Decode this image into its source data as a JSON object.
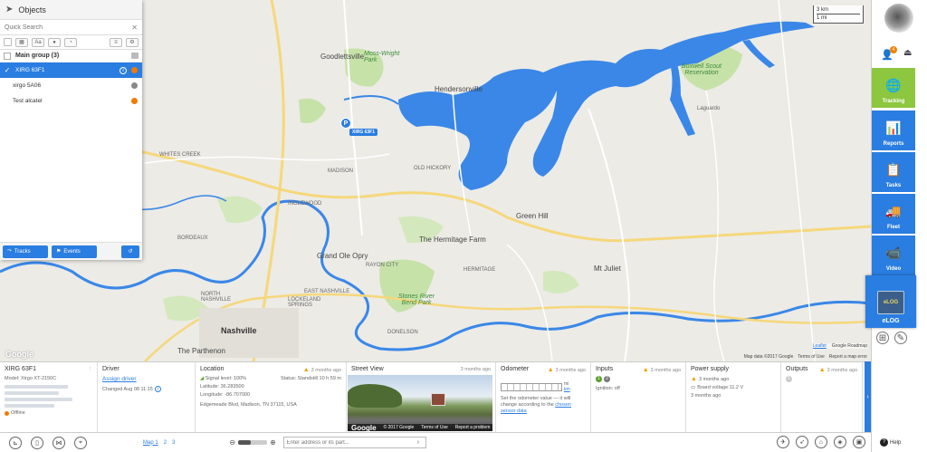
{
  "map": {
    "scale_km": "3 km",
    "scale_mi": "1 mi",
    "vehicle_marker": "P",
    "vehicle_tag": "XIRG 63F1",
    "labels": {
      "goodlettsville": "Goodlettsville",
      "moss_wright": "Moss-Wright Park",
      "hendersonville": "Hendersonville",
      "boxwell": "Boxwell Scout Reservation",
      "laguardo": "Laguardo",
      "madison": "MADISON",
      "old_hickory": "OLD HICKORY",
      "inglewood": "INGLEWOOD",
      "green_hill": "Green Hill",
      "hermitage": "The Hermitage Farm",
      "grand_ole_opry": "Grand Ole Opry",
      "mt_juliet": "Mt Juliet",
      "stones_river": "Stones River Bend Park",
      "nashville": "Nashville",
      "parthenon": "The Parthenon",
      "donelson": "DONELSON",
      "lockeland": "LOCKELAND SPRINGS",
      "east_nashville": "EAST NASHVILLE",
      "whites_creek": "WHITES CREEK",
      "bordeaux": "BORDEAUX",
      "north_nashville": "NORTH NASHVILLE",
      "hermitage_town": "HERMITAGE",
      "rayon_city": "RAYON CITY"
    },
    "google_logo": "Google",
    "attrib": {
      "data": "Map data ©2017 Google",
      "terms": "Terms of Use",
      "report": "Report a map error",
      "leaflet": "Leaflet",
      "roadmap": "Google Roadmap"
    },
    "colors": {
      "water": "#3a87e8",
      "park": "#c6e2a8",
      "land": "#ecebe6",
      "road": "#ffffff",
      "highway": "#f6d77a"
    }
  },
  "objects_panel": {
    "title": "Objects",
    "search_placeholder": "Quick Search",
    "group_label": "Main group (3)",
    "items": [
      {
        "name": "XIRG 63F1",
        "status_color": "#f07a00",
        "selected": true
      },
      {
        "name": "xirgo 5A06",
        "status_color": "#888888",
        "selected": false
      },
      {
        "name": "Test alcatel",
        "status_color": "#f07a00",
        "selected": false
      }
    ],
    "tracks_label": "Tracks",
    "events_label": "Events"
  },
  "nav": {
    "badge": "4",
    "tracking": "Tracking",
    "reports": "Reports",
    "tasks": "Tasks",
    "fleet": "Fleet",
    "video": "Video",
    "elog": "eLOG",
    "elog_logo": "eLOG",
    "help": "Help"
  },
  "info": {
    "object_title": "XIRG 63F1",
    "object_model": "Model: Xirgo XT-2150C",
    "object_status": "Offline",
    "driver_title": "Driver",
    "driver_assign": "Assign driver",
    "driver_changed": "Changed Aug 08 11:15",
    "location_title": "Location",
    "location_ago": "3 months ago",
    "signal": "Signal level: 100%",
    "status": "Status: Standstill 10 h 59 m",
    "latitude": "Latitude: 36.283500",
    "longitude": "Longitude: -86.707000",
    "address": "Edgemeade Blvd, Madison, TN 37115, USA",
    "sv_title": "Street View",
    "sv_ago": "3 months ago",
    "sv_google": "Google",
    "sv_copy": "© 2017 Google",
    "sv_terms": "Terms of Use",
    "sv_report": "Report a problem",
    "odo_title": "Odometer",
    "odo_ago": "3 months ago",
    "odo_unit_mi": "mi",
    "odo_unit_km": "km",
    "odo_note": "Set the odometer value — it will change according to the",
    "odo_link": "chosen sensor data",
    "inputs_title": "Inputs",
    "inputs_ago": "3 months ago",
    "inputs_1": "1",
    "inputs_2": "2",
    "ignition": "Ignition: off",
    "power_title": "Power supply",
    "power_ago": "3 months ago",
    "power_ago_2": "3 months ago",
    "board_voltage": "Board voltage:11.2 V",
    "power_ago_3": "3 months ago",
    "outputs_title": "Outputs",
    "outputs_ago": "3 months ago",
    "outputs_1": "1"
  },
  "bottom": {
    "map_tab_1": "Map 1",
    "map_tab_2": "2",
    "map_tab_3": "3",
    "zoom_minus": "⊖",
    "zoom_plus": "⊕",
    "zoom_level": 0.42,
    "address_placeholder": "Enter address or its part..."
  }
}
